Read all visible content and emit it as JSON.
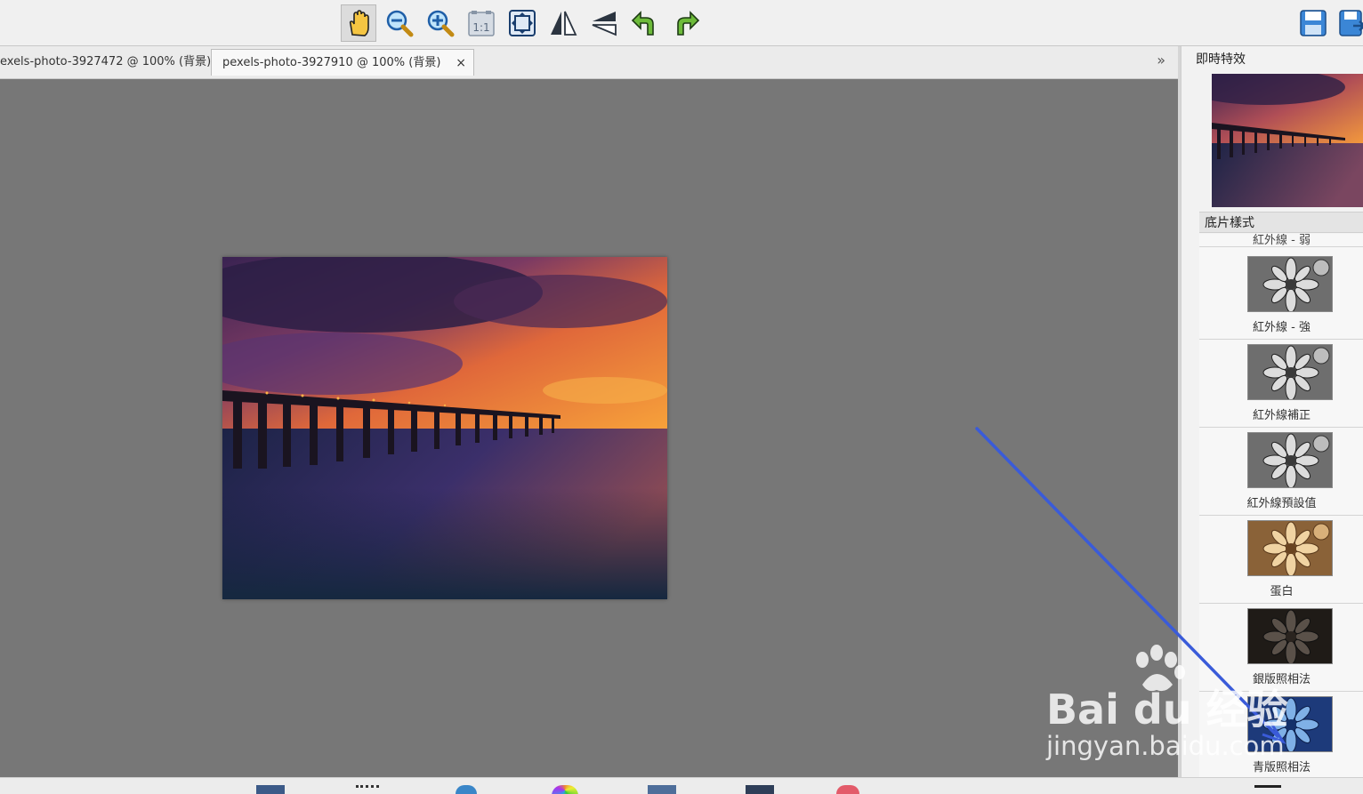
{
  "toolbar": {
    "tools": [
      {
        "icon": "hand-icon",
        "label": "pan-tool"
      },
      {
        "icon": "zoom-out-icon",
        "label": "zoom-out"
      },
      {
        "icon": "zoom-in-icon",
        "label": "zoom-in"
      },
      {
        "icon": "actual-size-icon",
        "label": "1:1"
      },
      {
        "icon": "fit-window-icon",
        "label": "fit-window"
      },
      {
        "icon": "flip-horizontal-icon",
        "label": "flip-horizontal"
      },
      {
        "icon": "flip-vertical-icon",
        "label": "flip-vertical"
      },
      {
        "icon": "rotate-left-icon",
        "label": "rotate-left"
      },
      {
        "icon": "rotate-right-icon",
        "label": "rotate-right"
      }
    ],
    "actual_size_text": "1:1"
  },
  "tabs": [
    {
      "label": "exels-photo-3927472 @ 100% (背景)",
      "active": false
    },
    {
      "label": "pexels-photo-3927910 @ 100% (背景)",
      "active": true,
      "close": "×"
    }
  ],
  "tab_scroll": "»",
  "panel": {
    "title": "即時特效",
    "section": "底片樣式",
    "partial_item": "紅外線 - 弱",
    "effects": [
      {
        "label": "紅外線 - 強",
        "style": "infrared"
      },
      {
        "label": "紅外線補正",
        "style": "infrared"
      },
      {
        "label": "紅外線預設值",
        "style": "infrared"
      },
      {
        "label": "蛋白",
        "style": "sepia"
      },
      {
        "label": "銀版照相法",
        "style": "dark"
      },
      {
        "label": "青版照相法",
        "style": "cyan"
      }
    ]
  },
  "watermark": {
    "logo": "Bai du 经验",
    "url": "jingyan.baidu.com"
  },
  "colors": {
    "canvas": "#777777",
    "annotation_line": "#3a5bd9"
  }
}
